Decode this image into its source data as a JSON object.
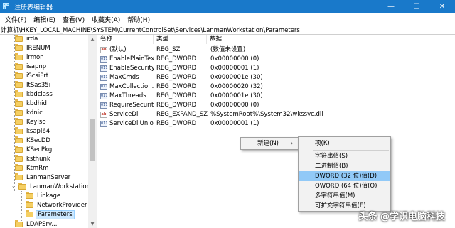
{
  "window": {
    "title": "注册表编辑器",
    "minimize": "—",
    "maximize": "☐",
    "close": "✕"
  },
  "menubar": {
    "items": [
      {
        "label": "文件(F)"
      },
      {
        "label": "编辑(E)"
      },
      {
        "label": "查看(V)"
      },
      {
        "label": "收藏夹(A)"
      },
      {
        "label": "帮助(H)"
      }
    ]
  },
  "address": "计算机\\HKEY_LOCAL_MACHINE\\SYSTEM\\CurrentControlSet\\Services\\LanmanWorkstation\\Parameters",
  "tree": {
    "items": [
      {
        "label": "irda"
      },
      {
        "label": "IRENUM"
      },
      {
        "label": "irmon"
      },
      {
        "label": "isapnp"
      },
      {
        "label": "iScsiPrt"
      },
      {
        "label": "ItSas35i"
      },
      {
        "label": "kbdclass"
      },
      {
        "label": "kbdhid"
      },
      {
        "label": "kdnic"
      },
      {
        "label": "KeyIso"
      },
      {
        "label": "ksapi64"
      },
      {
        "label": "KSecDD"
      },
      {
        "label": "KSecPkg"
      },
      {
        "label": "ksthunk"
      },
      {
        "label": "KtmRm"
      },
      {
        "label": "LanmanServer"
      },
      {
        "label": "LanmanWorkstation"
      },
      {
        "label": "Linkage"
      },
      {
        "label": "NetworkProvider"
      },
      {
        "label": "Parameters"
      },
      {
        "label": "LDAPSrv..."
      }
    ]
  },
  "columns": {
    "name": "名称",
    "type": "类型",
    "data": "数据"
  },
  "values": [
    {
      "icon": "ab",
      "name": "(默认)",
      "type": "REG_SZ",
      "data": "(数值未设置)"
    },
    {
      "icon": "011",
      "name": "EnablePlainTex...",
      "type": "REG_DWORD",
      "data": "0x00000000 (0)"
    },
    {
      "icon": "011",
      "name": "EnableSecurity...",
      "type": "REG_DWORD",
      "data": "0x00000001 (1)"
    },
    {
      "icon": "011",
      "name": "MaxCmds",
      "type": "REG_DWORD",
      "data": "0x0000001e (30)"
    },
    {
      "icon": "011",
      "name": "MaxCollection...",
      "type": "REG_DWORD",
      "data": "0x00000020 (32)"
    },
    {
      "icon": "011",
      "name": "MaxThreads",
      "type": "REG_DWORD",
      "data": "0x0000001e (30)"
    },
    {
      "icon": "011",
      "name": "RequireSecurit...",
      "type": "REG_DWORD",
      "data": "0x00000000 (0)"
    },
    {
      "icon": "ab",
      "name": "ServiceDll",
      "type": "REG_EXPAND_SZ",
      "data": "%SystemRoot%\\System32\\wkssvc.dll"
    },
    {
      "icon": "011",
      "name": "ServiceDllUnlo...",
      "type": "REG_DWORD",
      "data": "0x00000001 (1)"
    }
  ],
  "context_menu": {
    "new_label": "新建(N)",
    "arrow": "›"
  },
  "submenu": {
    "items": [
      {
        "label": "项(K)"
      },
      {
        "label": "字符串值(S)"
      },
      {
        "label": "二进制值(B)"
      },
      {
        "label": "DWORD (32 位)值(D)"
      },
      {
        "label": "QWORD (64 位)值(Q)"
      },
      {
        "label": "多字符串值(M)"
      },
      {
        "label": "可扩充字符串值(E)"
      }
    ],
    "highlighted": "DWORD (32 位)值(D)"
  },
  "watermark": "头条 @学识电脑科技",
  "colors": {
    "titlebar": "#1979ca",
    "selection": "#cce8ff",
    "menu_highlight": "#91c9f7"
  }
}
